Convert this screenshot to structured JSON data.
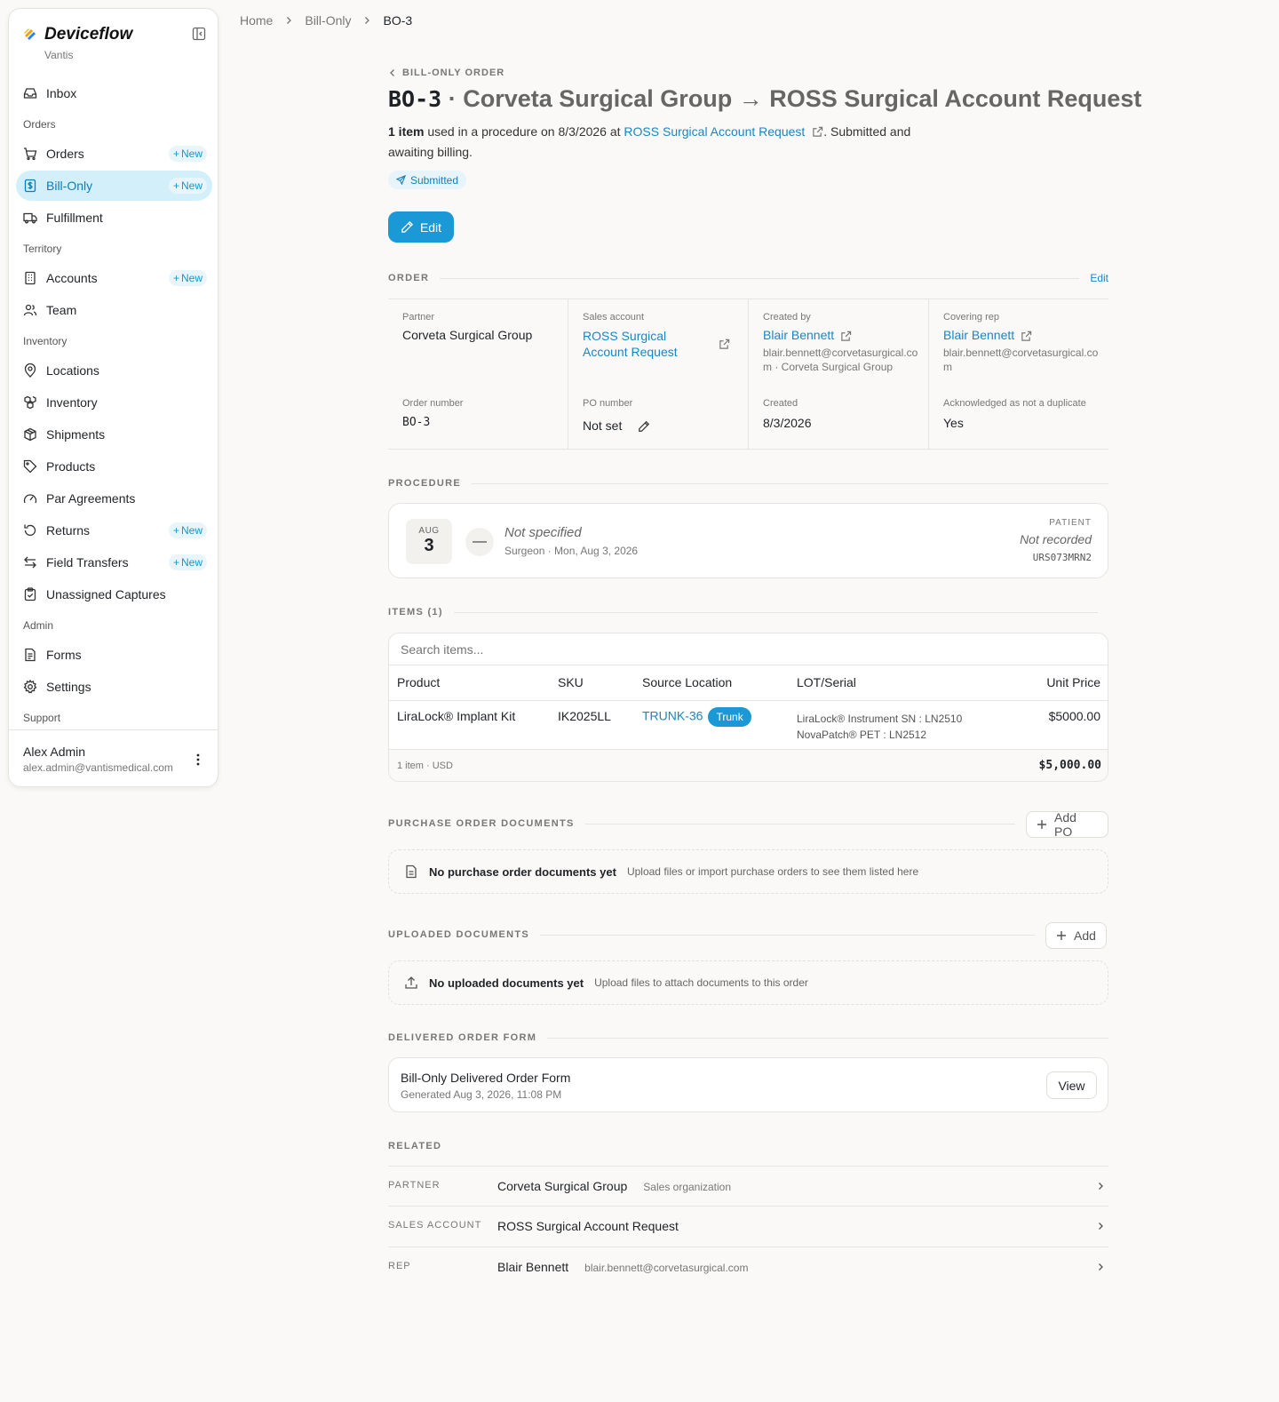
{
  "app": {
    "name": "Deviceflow",
    "org": "Vantis",
    "brand_colors": [
      "#f59e0b",
      "#2f80ed"
    ]
  },
  "nav": {
    "inbox": "Inbox",
    "sec_orders": "Orders",
    "orders": "Orders",
    "bill_only": "Bill-Only",
    "fulfillment": "Fulfillment",
    "sec_territory": "Territory",
    "accounts": "Accounts",
    "team": "Team",
    "sec_inventory": "Inventory",
    "locations": "Locations",
    "inventory": "Inventory",
    "shipments": "Shipments",
    "products": "Products",
    "par_agreements": "Par Agreements",
    "returns": "Returns",
    "field_transfers": "Field Transfers",
    "unassigned_captures": "Unassigned Captures",
    "sec_admin": "Admin",
    "forms": "Forms",
    "settings": "Settings",
    "sec_support": "Support",
    "new_label": "New"
  },
  "user": {
    "name": "Alex Admin",
    "email": "alex.admin@vantismedical.com"
  },
  "breadcrumb": [
    "Home",
    "Bill-Only",
    "BO-3"
  ],
  "header": {
    "back_label": "BILL-ONLY ORDER",
    "code": "BO-3",
    "title_rest": "· Corveta Surgical Group → ROSS Surgical Account Request",
    "lede_count": "1 item",
    "lede_mid": "used in a procedure on 8/3/2026 at",
    "lede_link": "ROSS Surgical Account Request",
    "lede_end": ". Submitted and awaiting billing.",
    "status": "Submitted",
    "edit": "Edit"
  },
  "order": {
    "section": "ORDER",
    "edit": "Edit",
    "partner_label": "Partner",
    "partner": "Corveta Surgical Group",
    "sales_label": "Sales account",
    "sales": "ROSS Surgical Account Request",
    "created_by_label": "Created by",
    "created_by": "Blair Bennett",
    "created_by_sub": "blair.bennett@corvetasurgical.com · Corveta Surgical Group",
    "rep_label": "Covering rep",
    "rep": "Blair Bennett",
    "rep_sub": "blair.bennett@corvetasurgical.com",
    "number_label": "Order number",
    "number": "BO-3",
    "po_label": "PO number",
    "po": "Not set",
    "created_label": "Created",
    "created": "8/3/2026",
    "dup_label": "Acknowledged as not a duplicate",
    "dup": "Yes"
  },
  "procedure": {
    "section": "PROCEDURE",
    "month": "AUG",
    "day": "3",
    "surgeon": "Not specified",
    "surgeon_sub": "Surgeon · Mon, Aug 3, 2026",
    "patient_label": "PATIENT",
    "patient": "Not recorded",
    "patient_id": "URS073MRN2"
  },
  "items": {
    "section": "ITEMS (1)",
    "search_placeholder": "Search items...",
    "columns": [
      "Product",
      "SKU",
      "Source Location",
      "LOT/Serial",
      "Unit Price"
    ],
    "rows": [
      {
        "product": "LiraLock® Implant Kit",
        "sku": "IK2025LL",
        "location": "TRUNK-36",
        "location_tag": "Trunk",
        "lot1": "LiraLock® Instrument SN : LN2510",
        "lot2": "NovaPatch® PET : LN2512",
        "price": "$5000.00"
      }
    ],
    "footer_left": "1 item · USD",
    "footer_total": "$5,000.00"
  },
  "po_docs": {
    "section": "PURCHASE ORDER DOCUMENTS",
    "add": "Add PO",
    "empty_title": "No purchase order documents yet",
    "empty_sub": "Upload files or import purchase orders to see them listed here"
  },
  "uploads": {
    "section": "UPLOADED DOCUMENTS",
    "add": "Add",
    "empty_title": "No uploaded documents yet",
    "empty_sub": "Upload files to attach documents to this order"
  },
  "dof": {
    "section": "DELIVERED ORDER FORM",
    "title": "Bill-Only Delivered Order Form",
    "sub": "Generated Aug 3, 2026, 11:08 PM",
    "view": "View"
  },
  "related": {
    "section": "RELATED",
    "rows": [
      {
        "key": "PARTNER",
        "value": "Corveta Surgical Group",
        "sub": "Sales organization"
      },
      {
        "key": "SALES ACCOUNT",
        "value": "ROSS Surgical Account Request",
        "sub": ""
      },
      {
        "key": "REP",
        "value": "Blair Bennett",
        "sub": "blair.bennett@corvetasurgical.com"
      }
    ]
  }
}
